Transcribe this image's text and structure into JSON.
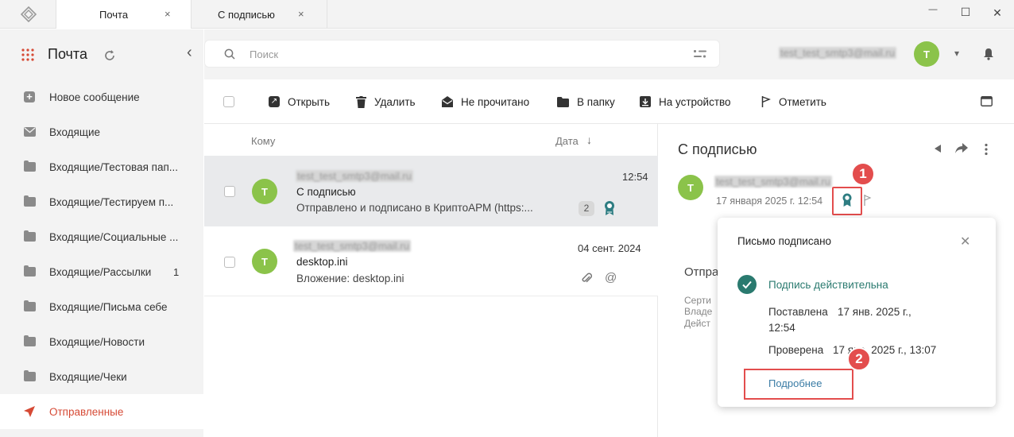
{
  "window": {
    "tabs": [
      {
        "label": "Почта"
      },
      {
        "label": "С подписью"
      }
    ],
    "close_glyph": "×",
    "minimize_glyph": "—",
    "maximize_glyph": "☐",
    "window_close_glyph": "✕"
  },
  "sidebar": {
    "app_title": "Почта",
    "collapse_glyph": "‹",
    "items": [
      {
        "label": "Новое сообщение",
        "icon": "plus-icon",
        "count": ""
      },
      {
        "label": "Входящие",
        "icon": "envelope-icon",
        "count": ""
      },
      {
        "label": "Входящие/Тестовая пап...",
        "icon": "folder-icon",
        "count": ""
      },
      {
        "label": "Входящие/Тестируем п...",
        "icon": "folder-icon",
        "count": ""
      },
      {
        "label": "Входящие/Социальные ...",
        "icon": "folder-icon",
        "count": ""
      },
      {
        "label": "Входящие/Рассылки",
        "icon": "folder-icon",
        "count": "1"
      },
      {
        "label": "Входящие/Письма себе",
        "icon": "folder-icon",
        "count": ""
      },
      {
        "label": "Входящие/Новости",
        "icon": "folder-icon",
        "count": ""
      },
      {
        "label": "Входящие/Чеки",
        "icon": "folder-icon",
        "count": ""
      },
      {
        "label": "Отправленные",
        "icon": "send-icon",
        "count": "",
        "active": true
      }
    ],
    "active_color": "#d64a35"
  },
  "header": {
    "search_placeholder": "Поиск",
    "user_email": "test_test_smtp3@mail.ru",
    "avatar_letter": "T",
    "dropdown_glyph": "▾"
  },
  "toolbar": {
    "buttons": [
      {
        "label": "Открыть",
        "icon": "open-icon"
      },
      {
        "label": "Удалить",
        "icon": "trash-icon"
      },
      {
        "label": "Не прочитано",
        "icon": "mail-open-icon"
      },
      {
        "label": "В папку",
        "icon": "folder-icon"
      },
      {
        "label": "На устройство",
        "icon": "download-icon"
      },
      {
        "label": "Отметить",
        "icon": "flag-icon"
      }
    ]
  },
  "list": {
    "col_to": "Кому",
    "col_date": "Дата",
    "sort_glyph": "↓",
    "rows": [
      {
        "avatar": "T",
        "recipient": "test_test_smtp3@mail.ru",
        "subject": "С подписью",
        "preview": "Отправлено и подписано в КриптоАРМ (https:...",
        "date": "12:54",
        "count": "2",
        "selected": true
      },
      {
        "avatar": "T",
        "recipient": "test_test_smtp3@mail.ru",
        "subject": "desktop.ini",
        "preview": "Вложение: desktop.ini",
        "date": "04 сент. 2024",
        "selected": false
      }
    ]
  },
  "reader": {
    "title": "С подписью",
    "avatar": "T",
    "sender": "test_test_smtp3@mail.ru",
    "date": "17 января 2025 г. 12:54",
    "body_label": "Отпра",
    "details": [
      "Серти",
      "Владе",
      "Дейст"
    ]
  },
  "popup": {
    "title": "Письмо подписано",
    "status": "Подпись действительна",
    "placed_label": "Поставлена",
    "placed_value_1": "17 янв. 2025 г.,",
    "placed_value_2": "12:54",
    "checked_label": "Проверена",
    "checked_value": "17 янв. 2025 г., 13:07",
    "more_link": "Подробнее",
    "close_glyph": "✕",
    "status_color": "#2a7a6f"
  },
  "markers": [
    "1",
    "2"
  ]
}
